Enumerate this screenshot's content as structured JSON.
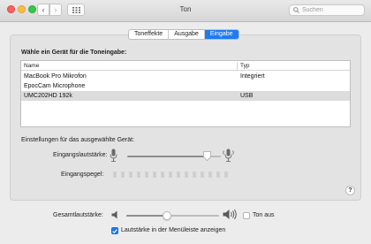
{
  "window": {
    "title": "Ton",
    "search_placeholder": "Suchen",
    "back_glyph": "‹",
    "forward_glyph": "›"
  },
  "tabs": [
    {
      "label": "Toneffekte",
      "active": false
    },
    {
      "label": "Ausgabe",
      "active": false
    },
    {
      "label": "Eingabe",
      "active": true
    }
  ],
  "input": {
    "heading": "Wähle ein Gerät für die Toneingabe:",
    "columns": {
      "name": "Name",
      "type": "Typ"
    },
    "devices": [
      {
        "name": "MacBook Pro Mikrofon",
        "type": "Integriert",
        "selected": false
      },
      {
        "name": "EpocCam Microphone",
        "type": "",
        "selected": false
      },
      {
        "name": "UMC202HD 192k",
        "type": "USB",
        "selected": true
      }
    ],
    "settings_label": "Einstellungen für das ausgewählte Gerät:",
    "volume_label": "Eingangslautstärke:",
    "volume_level": 0.85,
    "level_label": "Eingangspegel:",
    "level_segments": 15,
    "level_active": 0,
    "help_glyph": "?"
  },
  "output_volume": {
    "label": "Gesamtlautstärke:",
    "level": 0.44,
    "mute_label": "Ton aus",
    "muted": false
  },
  "menubar_checkbox": {
    "label": "Lautstärke in der Menüleiste anzeigen",
    "checked": true
  },
  "colors": {
    "accent": "#1f7bf2",
    "tab_active_text": "#ffffff"
  },
  "icons": {
    "mic_low": "microphone-low-icon",
    "mic_high": "microphone-high-icon",
    "speaker_low": "speaker-low-icon",
    "speaker_high": "speaker-high-icon",
    "grid": "grid-icon",
    "search": "search-icon"
  }
}
